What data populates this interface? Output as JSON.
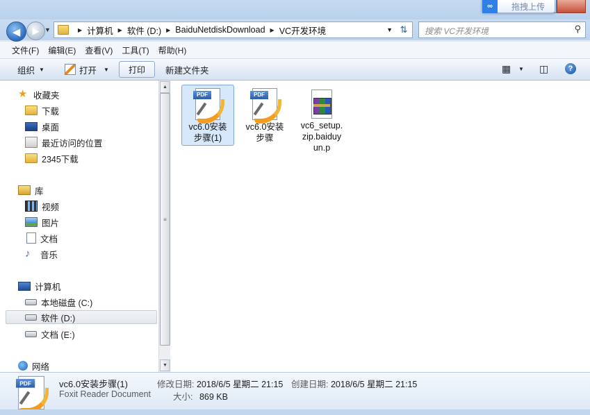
{
  "baidu_float": {
    "label": "拖拽上传"
  },
  "address": {
    "crumbs": [
      "计算机",
      "软件 (D:)",
      "BaiduNetdiskDownload",
      "VC开发环境"
    ]
  },
  "search": {
    "placeholder": "搜索 VC开发环境"
  },
  "menu": [
    "文件(F)",
    "编辑(E)",
    "查看(V)",
    "工具(T)",
    "帮助(H)"
  ],
  "toolbar": {
    "organize": "组织",
    "open": "打开",
    "print": "打印",
    "new_folder": "新建文件夹"
  },
  "nav": {
    "favorites": "收藏夹",
    "downloads": "下载",
    "desktop": "桌面",
    "recent": "最近访问的位置",
    "dl2345": "2345下载",
    "libraries": "库",
    "videos": "视频",
    "pictures": "图片",
    "documents": "文档",
    "music": "音乐",
    "computer": "计算机",
    "drive_c": "本地磁盘 (C:)",
    "drive_d": "软件 (D:)",
    "drive_e": "文档 (E:)",
    "network": "网络"
  },
  "files": [
    {
      "line1": "vc6.0安装",
      "line2": "步骤(1)",
      "icon": "pdf",
      "selected": true
    },
    {
      "line1": "vc6.0安装",
      "line2": "步骤",
      "icon": "pdf",
      "selected": false
    },
    {
      "line1": "vc6_setup.",
      "line2": "zip.baiduy",
      "line3": "un.p",
      "icon": "winrar",
      "selected": false
    }
  ],
  "details": {
    "name": "vc6.0安装步骤(1)",
    "type": "Foxit Reader Document",
    "modified_label": "修改日期:",
    "modified_value": "2018/6/5 星期二 21:15",
    "created_label": "创建日期:",
    "created_value": "2018/6/5 星期二 21:15",
    "size_label": "大小:",
    "size_value": "869 KB"
  },
  "colors": {
    "accent": "#2f7fe6",
    "selection": "#d7e8fb",
    "pdf_orange": "#f39c1e"
  }
}
